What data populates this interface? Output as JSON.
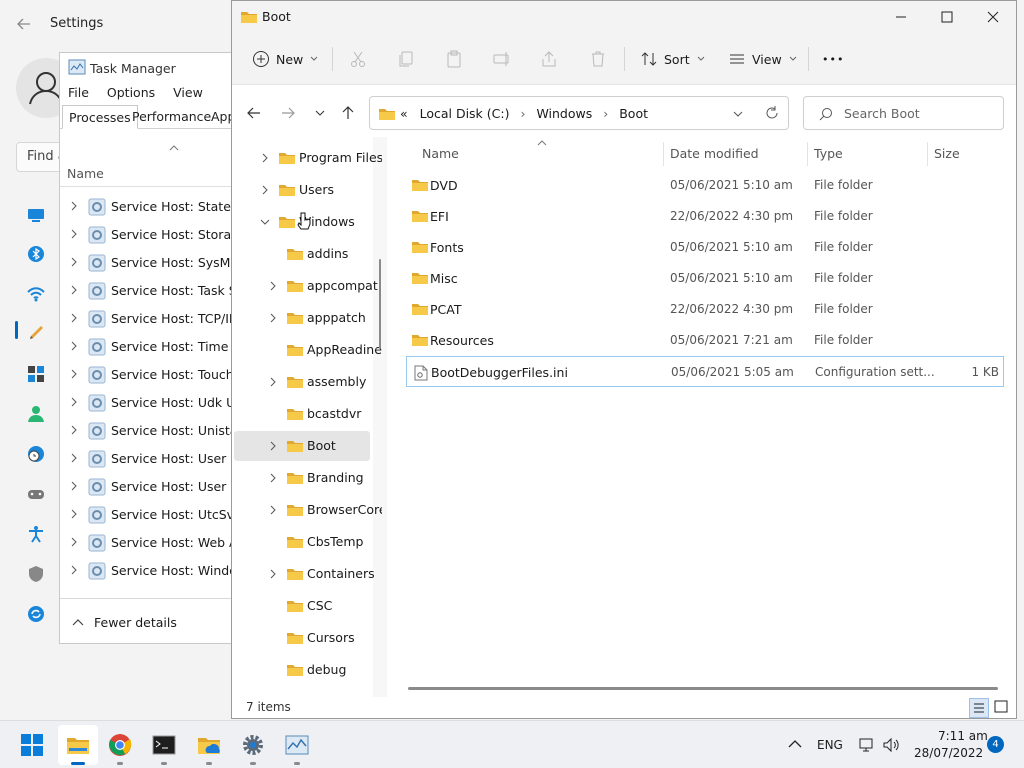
{
  "settings": {
    "title": "Settings",
    "search_placeholder": "Find a"
  },
  "task_manager": {
    "title": "Task Manager",
    "menu": [
      "File",
      "Options",
      "View"
    ],
    "tabs": [
      "Processes",
      "Performance",
      "App"
    ],
    "column_name": "Name",
    "rows": [
      "Service Host: State Rep",
      "Service Host: Storage S",
      "Service Host: SysMain",
      "Service Host: Task Sche",
      "Service Host: TCP/IP Ne",
      "Service Host: Time Brok",
      "Service Host: Touch Key",
      "Service Host: Udk User",
      "Service Host: Unistack",
      "Service Host: User Man",
      "Service Host: User Prof",
      "Service Host: UtcSvc",
      "Service Host: Web Acce",
      "Service Host: Windows"
    ],
    "fewer_details": "Fewer details"
  },
  "explorer": {
    "title": "Boot",
    "toolbar": {
      "new_label": "New",
      "sort_label": "Sort",
      "view_label": "View",
      "more_label": "•••"
    },
    "address": {
      "prefix": "«",
      "crumbs": [
        "Local Disk (C:)",
        "Windows",
        "Boot"
      ],
      "sep": "›"
    },
    "search_placeholder": "Search Boot",
    "tree": [
      {
        "label": "Program Files",
        "chevron": "right",
        "level": 0
      },
      {
        "label": "Users",
        "chevron": "right",
        "level": 0
      },
      {
        "label": "Windows",
        "chevron": "down",
        "level": 0
      },
      {
        "label": "addins",
        "chevron": "none",
        "level": 1
      },
      {
        "label": "appcompat",
        "chevron": "right",
        "level": 1
      },
      {
        "label": "apppatch",
        "chevron": "right",
        "level": 1
      },
      {
        "label": "AppReadine",
        "chevron": "none",
        "level": 1
      },
      {
        "label": "assembly",
        "chevron": "right",
        "level": 1
      },
      {
        "label": "bcastdvr",
        "chevron": "none",
        "level": 1
      },
      {
        "label": "Boot",
        "chevron": "right",
        "level": 1,
        "selected": true
      },
      {
        "label": "Branding",
        "chevron": "right",
        "level": 1
      },
      {
        "label": "BrowserCore",
        "chevron": "right",
        "level": 1
      },
      {
        "label": "CbsTemp",
        "chevron": "none",
        "level": 1
      },
      {
        "label": "Containers",
        "chevron": "right",
        "level": 1
      },
      {
        "label": "CSC",
        "chevron": "none",
        "level": 1
      },
      {
        "label": "Cursors",
        "chevron": "none",
        "level": 1
      },
      {
        "label": "debug",
        "chevron": "none",
        "level": 1
      }
    ],
    "columns": {
      "name": "Name",
      "date": "Date modified",
      "type": "Type",
      "size": "Size"
    },
    "files": [
      {
        "name": "DVD",
        "date": "05/06/2021 5:10 am",
        "type": "File folder",
        "size": "",
        "kind": "folder"
      },
      {
        "name": "EFI",
        "date": "22/06/2022 4:30 pm",
        "type": "File folder",
        "size": "",
        "kind": "folder"
      },
      {
        "name": "Fonts",
        "date": "05/06/2021 5:10 am",
        "type": "File folder",
        "size": "",
        "kind": "folder"
      },
      {
        "name": "Misc",
        "date": "05/06/2021 5:10 am",
        "type": "File folder",
        "size": "",
        "kind": "folder"
      },
      {
        "name": "PCAT",
        "date": "22/06/2022 4:30 pm",
        "type": "File folder",
        "size": "",
        "kind": "folder"
      },
      {
        "name": "Resources",
        "date": "05/06/2021 7:21 am",
        "type": "File folder",
        "size": "",
        "kind": "folder"
      },
      {
        "name": "BootDebuggerFiles.ini",
        "date": "05/06/2021 5:05 am",
        "type": "Configuration sett...",
        "size": "1 KB",
        "kind": "file"
      }
    ],
    "status": "7 items"
  },
  "taskbar": {
    "language": "ENG",
    "time": "7:11 am",
    "date": "28/07/2022",
    "notifications": "4"
  },
  "colors": {
    "accent": "#0067c0",
    "folder": "#f7c948",
    "folder_dark": "#e0a82e"
  }
}
